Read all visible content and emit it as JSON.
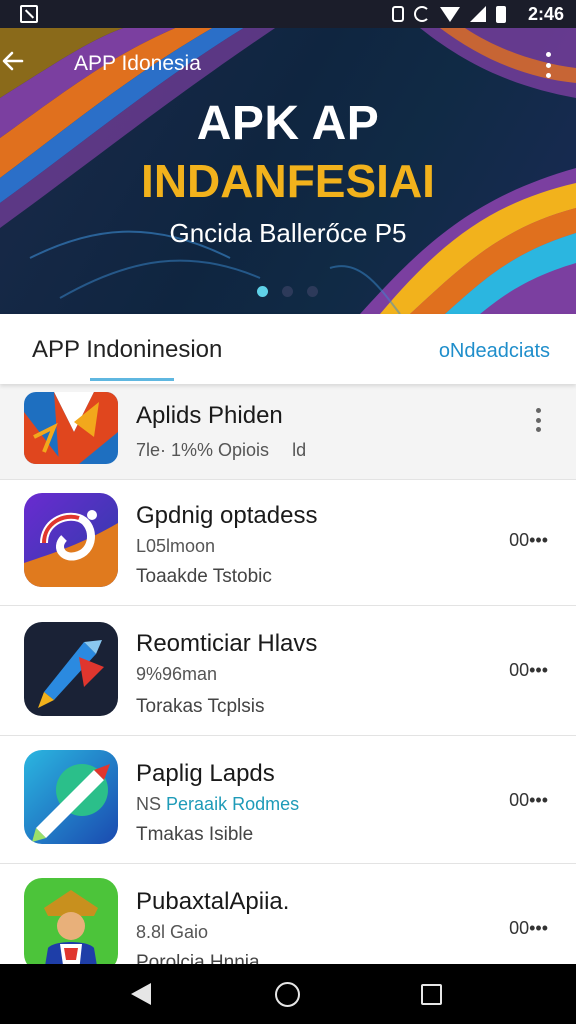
{
  "status_bar": {
    "time": "2:46"
  },
  "header": {
    "title": "APP Idonesia"
  },
  "hero": {
    "title_line1": "APK AP",
    "title_line2": "INDANFESIAI",
    "subtitle": "Gncida Ballerőce P5",
    "carousel_active_index": 0,
    "carousel_count": 3
  },
  "tabs": {
    "left_label": "APP Indoninesion",
    "right_label": "oNdeadciats"
  },
  "apps": [
    {
      "name": "Aplids Phiden",
      "meta": "7le· 1%% Opiois",
      "meta_extra": "ld",
      "sub": "",
      "size": ""
    },
    {
      "name": "Gpdnig optadess",
      "meta": "L05lmoon",
      "sub": "Toaakde Tstobic",
      "size": "00•••"
    },
    {
      "name": "Reomticiar Hlavs",
      "meta": "9%96man",
      "sub": "Torakas Tcplsis",
      "size": "00•••"
    },
    {
      "name": "Paplig Lapds",
      "meta_prefix": "NS",
      "meta": "Peraaik Rodmes",
      "sub": "Tmakas Isible",
      "size": "00•••"
    },
    {
      "name": "PubaxtalApiia.",
      "meta": "8.8l Gaio",
      "sub": "Porolcia Hnnia",
      "size": "00•••"
    }
  ],
  "colors": {
    "accent": "#1f8ecb",
    "hero_gold": "#f2b21c",
    "indicator": "#5fd2e8"
  }
}
